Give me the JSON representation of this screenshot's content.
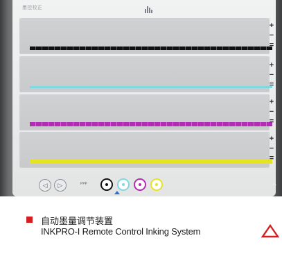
{
  "screen": {
    "title": "墨控校正",
    "panels": [
      {
        "ink": "black",
        "color": "#111111",
        "controls": [
          "+",
          "−",
          "="
        ]
      },
      {
        "ink": "cyan",
        "color": "#7fd8e0",
        "controls": [
          "+",
          "−",
          "="
        ]
      },
      {
        "ink": "magenta",
        "color": "#b42bb8",
        "controls": [
          "+",
          "−",
          "="
        ]
      },
      {
        "ink": "yellow",
        "color": "#e6e322",
        "controls": [
          "+",
          "−",
          "="
        ]
      }
    ],
    "toolbar": {
      "btn_left": "◁",
      "btn_right": "▷",
      "mode_text": "PPP",
      "ink_selector": [
        {
          "label": "K",
          "color": "#111111",
          "selected": true
        },
        {
          "label": "C",
          "color": "#7fd8e0",
          "selected": false
        },
        {
          "label": "M",
          "color": "#b42bb8",
          "selected": false
        },
        {
          "label": "Y",
          "color": "#e6e322",
          "selected": false
        }
      ]
    }
  },
  "caption": {
    "title_zh": "自动墨量调节装置",
    "title_en": "INKPRO-I Remote Control Inking System",
    "accent_color": "#d51e22"
  }
}
